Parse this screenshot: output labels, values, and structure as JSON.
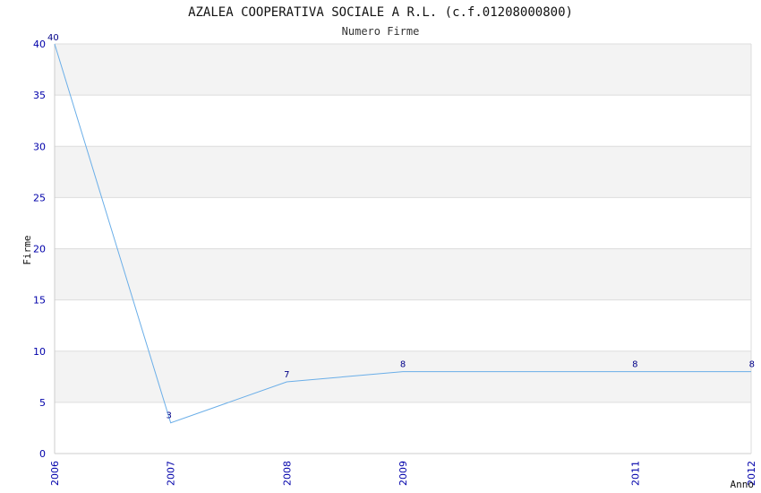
{
  "chart_data": {
    "type": "line",
    "title": "AZALEA COOPERATIVA SOCIALE A R.L. (c.f.01208000800)",
    "subtitle": "Numero Firme",
    "xlabel": "Anno",
    "ylabel": "Firme",
    "x": [
      "2006",
      "2007",
      "2008",
      "2009",
      "2011",
      "2012"
    ],
    "values": [
      40,
      3,
      7,
      8,
      8,
      8
    ],
    "data_labels": [
      "40",
      "3",
      "7",
      "8",
      "8",
      "8"
    ],
    "ylim": [
      0,
      40
    ],
    "yticks": [
      "0",
      "5",
      "10",
      "15",
      "20",
      "25",
      "30",
      "35",
      "40"
    ],
    "grid": true,
    "legend": "none",
    "colors": {
      "line": "#6aaee8",
      "band": "#f3f3f3",
      "grid": "#dddddd",
      "tick": "#0000aa"
    }
  }
}
